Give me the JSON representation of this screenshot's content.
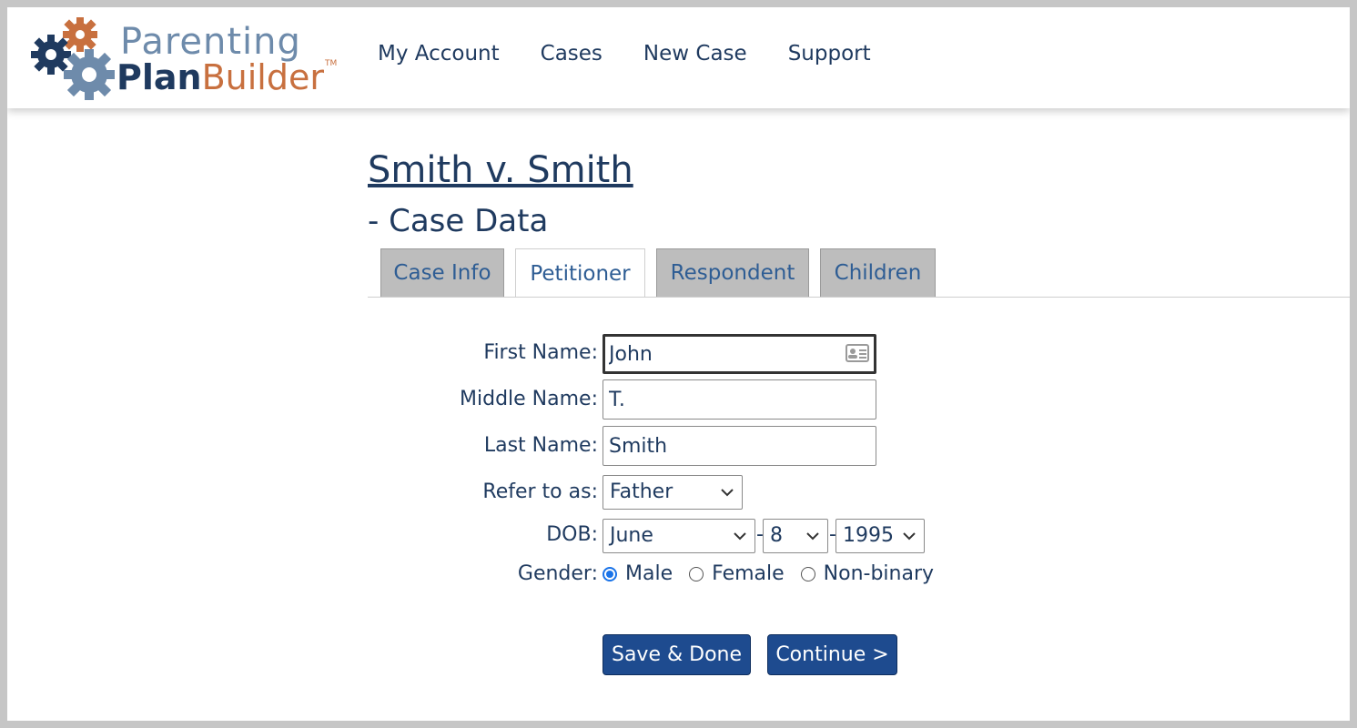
{
  "brand": {
    "line1": "Parenting",
    "plan": "Plan",
    "builder": "Builder",
    "tm": "TM",
    "colors": {
      "navy": "#1f3a5f",
      "slate": "#6e8bab",
      "orange": "#c8703f"
    }
  },
  "nav": [
    "My Account",
    "Cases",
    "New Case",
    "Support"
  ],
  "case": {
    "title": "Smith v. Smith",
    "subtitle": "- Case Data"
  },
  "tabs": [
    {
      "label": "Case Info",
      "active": false
    },
    {
      "label": "Petitioner",
      "active": true
    },
    {
      "label": "Respondent",
      "active": false
    },
    {
      "label": "Children",
      "active": false
    }
  ],
  "form": {
    "first_name": {
      "label": "First Name:",
      "value": "John"
    },
    "middle_name": {
      "label": "Middle Name:",
      "value": "T."
    },
    "last_name": {
      "label": "Last Name:",
      "value": "Smith"
    },
    "refer_to": {
      "label": "Refer to as:",
      "value": "Father"
    },
    "dob": {
      "label": "DOB:",
      "month": "June",
      "day": "8",
      "year": "1995",
      "separator": "-"
    },
    "gender": {
      "label": "Gender:",
      "options": [
        "Male",
        "Female",
        "Non-binary"
      ],
      "selected": "Male"
    }
  },
  "buttons": {
    "save": "Save & Done",
    "continue": "Continue >"
  },
  "icons": {
    "contact_card": "contact-card-icon",
    "chevron": "chevron-down-icon",
    "gear": "gear-icon"
  },
  "accent_colors": {
    "primary_button": "#1e4b8f",
    "tab_inactive": "#bdbdbd",
    "radio_checked": "#1a73e8"
  }
}
